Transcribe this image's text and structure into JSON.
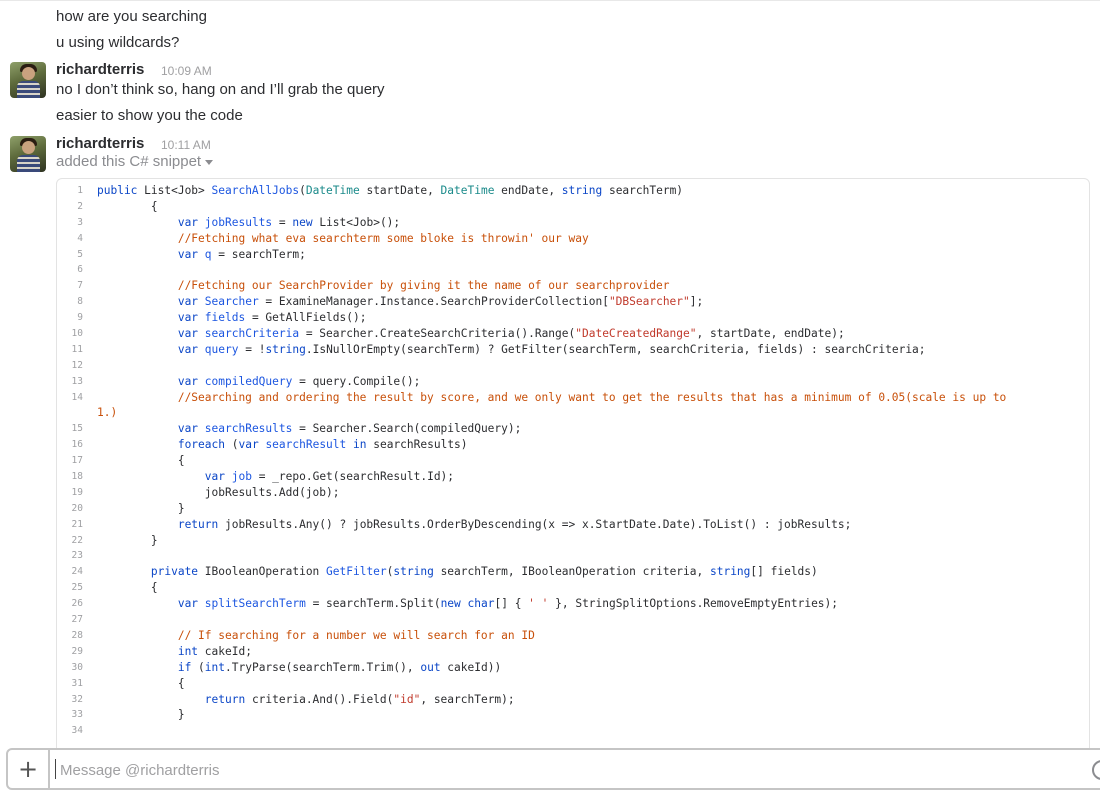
{
  "messages_top": [
    "how are you searching",
    "u using wildcards?"
  ],
  "post1": {
    "user": "richardterris",
    "time": "10:09 AM",
    "lines": [
      "no I don’t think so, hang on and I’ll grab the query",
      "easier to show you the code"
    ]
  },
  "post2": {
    "user": "richardterris",
    "time": "10:11 AM",
    "action": "added this C# snippet"
  },
  "snippet_lines": [
    "1",
    "2",
    "3",
    "4",
    "5",
    "6",
    "7",
    "8",
    "9",
    "10",
    "11",
    "12",
    "13",
    "14",
    "",
    "15",
    "16",
    "17",
    "18",
    "19",
    "20",
    "21",
    "22",
    "23",
    "24",
    "25",
    "26",
    "27",
    "28",
    "29",
    "30",
    "31",
    "32",
    "33",
    "34"
  ],
  "composer": {
    "placeholder": "Message @richardterris"
  },
  "colors": {
    "keyword": "#0b46c7",
    "type": "#1a8a8a",
    "string": "#c0392b",
    "comment": "#c8500a"
  }
}
